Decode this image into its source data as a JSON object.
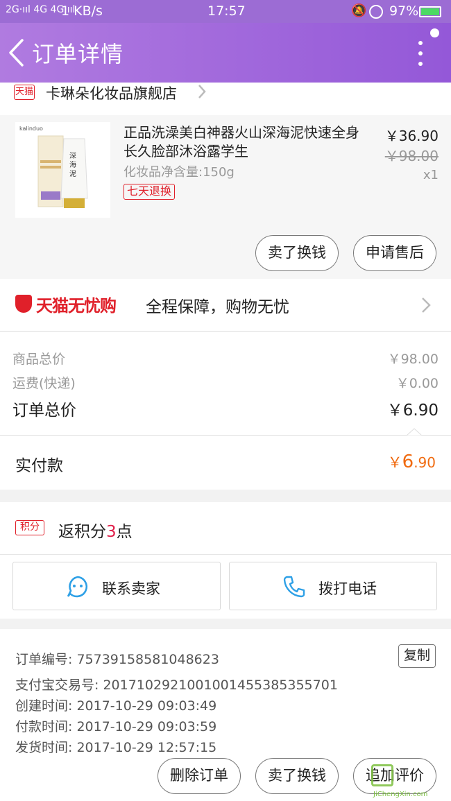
{
  "status_bar": {
    "network": "2G·ııl 4G 4G·ııl",
    "speed": "1 KB/s",
    "time": "17:57",
    "battery": "97%"
  },
  "header": {
    "title": "订单详情"
  },
  "store": {
    "badge": "天猫",
    "name": "卡琳朵化妆品旗舰店"
  },
  "product": {
    "image_brand": "kalinduo",
    "image_tube_text": "深海泥",
    "title": "正品洗澡美白神器火山深海泥快速全身长久脸部沐浴露学生",
    "spec": "化妆品净含量:150g",
    "badge": "七天退换",
    "price": "￥36.90",
    "original_price": "￥98.00",
    "quantity": "x1",
    "actions": [
      "卖了换钱",
      "申请售后"
    ]
  },
  "guarantee": {
    "brand": "天猫无忧购",
    "text": "全程保障，购物无忧"
  },
  "summary": {
    "items_label": "商品总价",
    "items_value": "￥98.00",
    "shipping_label": "运费(快递)",
    "shipping_value": "￥0.00",
    "total_label": "订单总价",
    "total_value": "￥6.90"
  },
  "payment": {
    "label": "实付款",
    "currency": "￥",
    "integer": "6",
    "decimal": ".90"
  },
  "points": {
    "badge": "积分",
    "prefix": "返积分",
    "count": "3",
    "suffix": "点"
  },
  "contact": {
    "seller_label": "联系卖家",
    "phone_label": "拨打电话"
  },
  "order_info": {
    "order_no": "订单编号: 757391585810486​23",
    "alipay_no": "支付宝交易号: 2017102921001001455385355701",
    "created": "创建时间: 2017-10-29 09:03:49",
    "paid": "付款时间: 2017-10-29 09:03:59",
    "shipped": "发货时间: 2017-10-29 12:57:15",
    "copy_label": "复制"
  },
  "bottom_actions": [
    "删除订单",
    "卖了换钱",
    "追加评价"
  ],
  "watermark": {
    "text": "JiChengXin.com"
  },
  "colors": {
    "header": "#9c6cd4",
    "tmall_red": "#e0202a",
    "pay_orange": "#f06a0f",
    "points_red": "#e0204a"
  }
}
